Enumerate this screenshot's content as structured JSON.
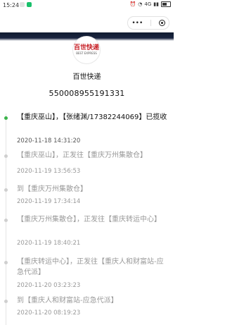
{
  "status_bar": {
    "time": "15:24",
    "network": "4G",
    "battery_icon": "battery-icon"
  },
  "nav": {
    "more_label": "•••",
    "close_icon": "target-icon"
  },
  "header": {
    "logo_mark": "百世快递",
    "logo_sub": "BEST EXPRESS",
    "company": "百世快递",
    "waybill": "550008955191331"
  },
  "timeline": [
    {
      "text": "【重庆巫山】，【张绪渊/17382244069】已揽收",
      "time": "2020-11-18 14:31:20",
      "active": true
    },
    {
      "text": "【重庆巫山】，正发往【重庆万州集散仓】",
      "time": "2020-11-19 13:56:53",
      "active": false
    },
    {
      "text": "到【重庆万州集散仓】",
      "time": "2020-11-19 17:34:14",
      "active": false
    },
    {
      "text": "【重庆万州集散仓】，正发往【重庆转运中心】",
      "time": "2020-11-19 18:40:21",
      "active": false
    },
    {
      "text": "【重庆转运中心】，正发往【重庆人和财富站-应急代派】",
      "time": "2020-11-20 03:23:23",
      "active": false
    },
    {
      "text": "到【重庆人和财富站-应急代派】",
      "time": "2020-11-20 08:19:23",
      "active": false
    }
  ]
}
